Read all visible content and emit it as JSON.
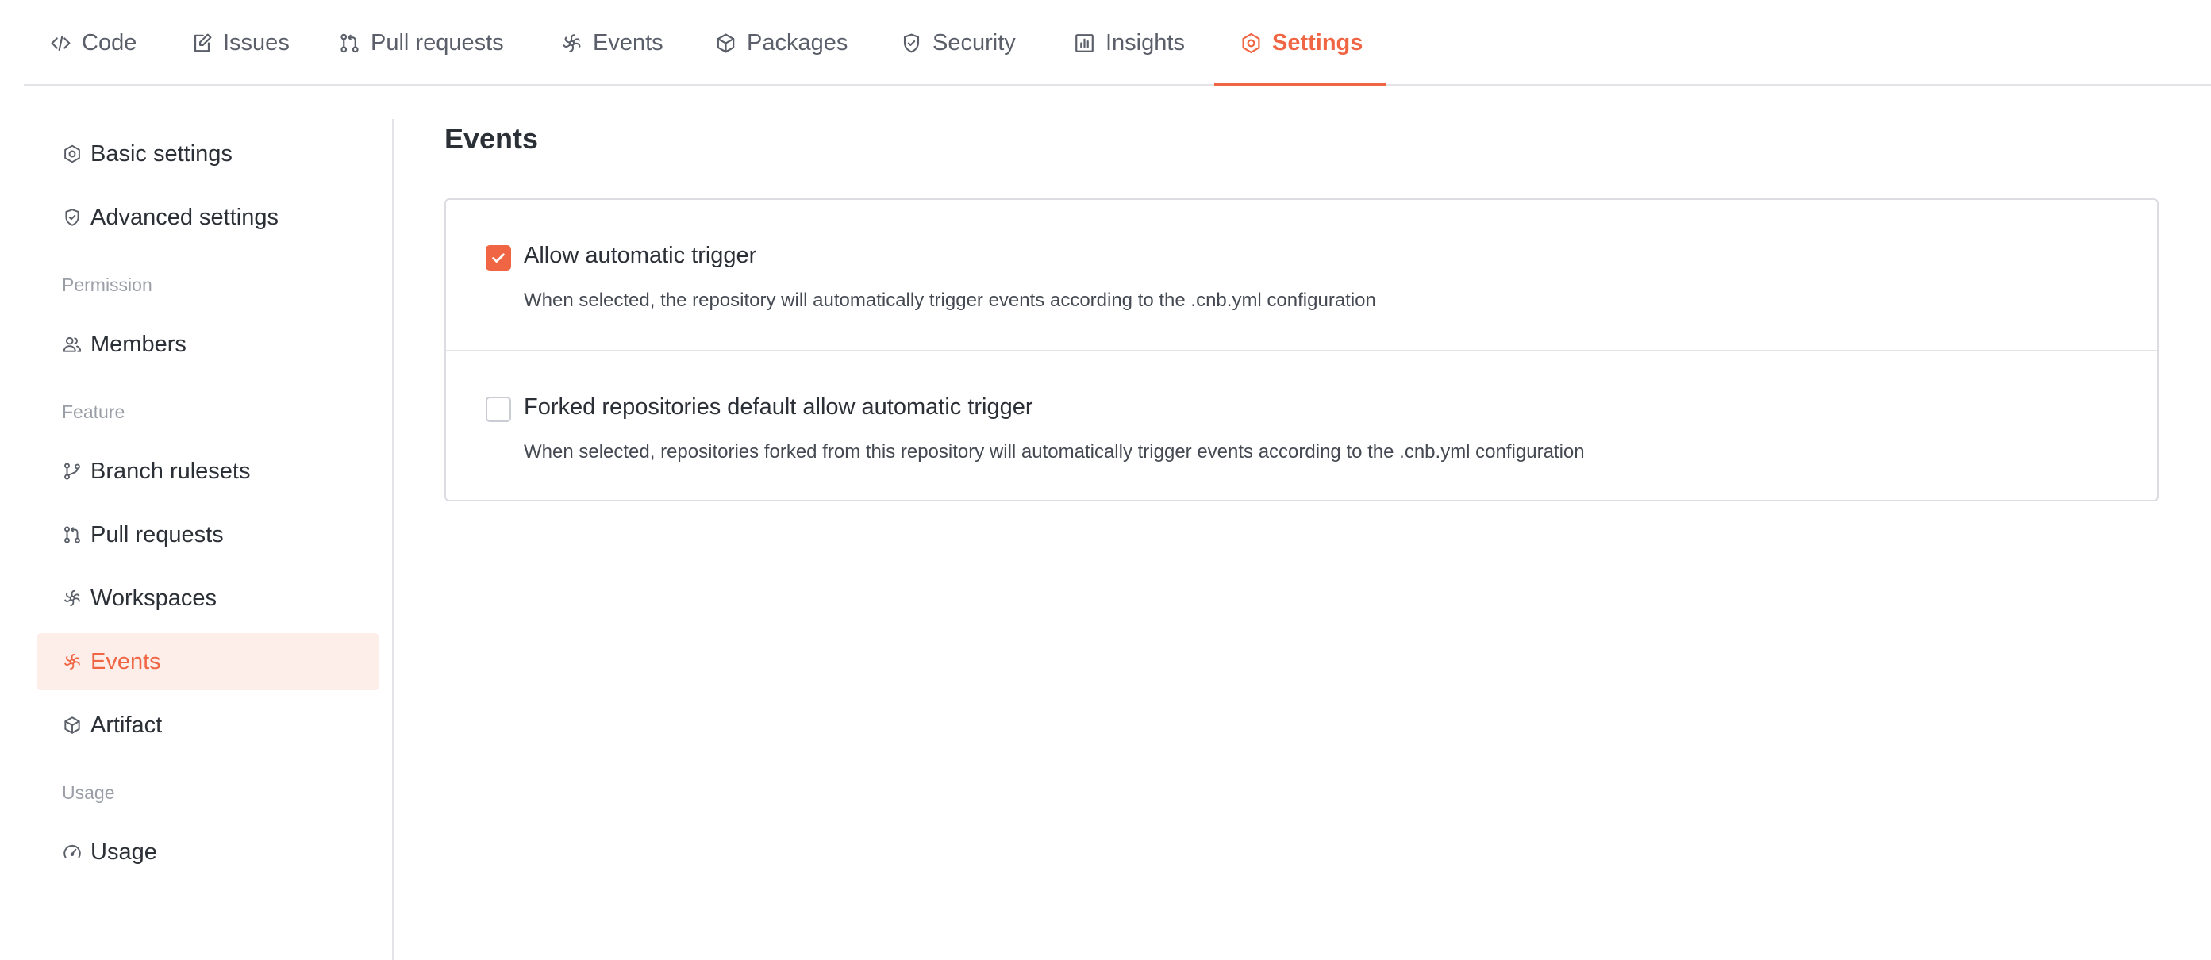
{
  "tabs": [
    {
      "label": "Code",
      "icon": "code-icon"
    },
    {
      "label": "Issues",
      "icon": "issue-icon"
    },
    {
      "label": "Pull requests",
      "icon": "pull-request-icon"
    },
    {
      "label": "Events",
      "icon": "events-icon"
    },
    {
      "label": "Packages",
      "icon": "package-icon"
    },
    {
      "label": "Security",
      "icon": "shield-icon"
    },
    {
      "label": "Insights",
      "icon": "chart-icon"
    },
    {
      "label": "Settings",
      "icon": "settings-icon"
    }
  ],
  "active_tab": "Settings",
  "accent_color": "#f06543",
  "sidebar": {
    "items": [
      {
        "label": "Basic settings",
        "icon": "settings-icon"
      },
      {
        "label": "Advanced settings",
        "icon": "shield-icon"
      },
      {
        "label": "Members",
        "icon": "members-icon"
      },
      {
        "label": "Branch rulesets",
        "icon": "branch-icon"
      },
      {
        "label": "Pull requests",
        "icon": "pull-request-icon"
      },
      {
        "label": "Workspaces",
        "icon": "workspaces-icon"
      },
      {
        "label": "Events",
        "icon": "events-icon"
      },
      {
        "label": "Artifact",
        "icon": "package-icon"
      },
      {
        "label": "Usage",
        "icon": "gauge-icon"
      }
    ],
    "groups": {
      "permission": "Permission",
      "feature": "Feature",
      "usage": "Usage"
    },
    "active_item": "Events"
  },
  "main": {
    "title": "Events",
    "options": [
      {
        "label": "Allow automatic trigger",
        "description": "When selected, the repository will automatically trigger events according to the .cnb.yml configuration",
        "checked": true
      },
      {
        "label": "Forked repositories default allow automatic trigger",
        "description": "When selected, repositories forked from this repository will automatically trigger events according to the .cnb.yml configuration",
        "checked": false
      }
    ]
  }
}
